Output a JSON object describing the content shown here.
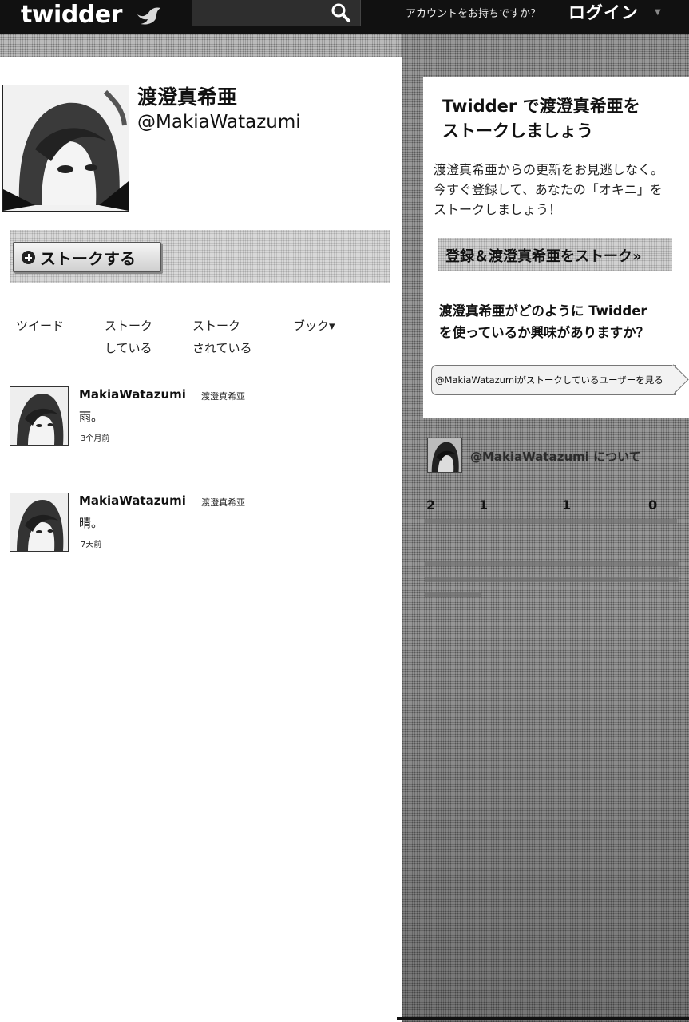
{
  "topbar": {
    "logo": "twidder",
    "login_question": "アカウントをお持ちですか？",
    "login_link": "ログイン",
    "login_caret": "▼"
  },
  "profile": {
    "display_name": "渡澄真希亜",
    "handle": "@MakiaWatazumi",
    "stalk_button": "ストークする"
  },
  "stats": [
    {
      "line1": "ツイード",
      "line2": ""
    },
    {
      "line1": "ストーク",
      "line2": "している"
    },
    {
      "line1": "ストーク",
      "line2": "されている"
    },
    {
      "line1": "ブック▾",
      "line2": ""
    }
  ],
  "tweets": [
    {
      "user": "MakiaWatazumi",
      "name": "渡澄真希亚",
      "text": "雨。",
      "time": "3个月前"
    },
    {
      "user": "MakiaWatazumi",
      "name": "渡澄真希亚",
      "text": "晴。",
      "time": "7天前"
    }
  ],
  "signup": {
    "title_line1": "Twidder で渡澄真希亜を",
    "title_line2": "ストークしましょう",
    "desc_line1": "渡澄真希亜からの更新をお見逃しなく。",
    "desc_line2": "今すぐ登録して、あなたの「オキニ」を",
    "desc_line3": "ストークしましょう！",
    "button": "登録＆渡澄真希亜をストーク»",
    "curious_line1": "渡澄真希亜がどのように Twidder",
    "curious_line2": "を使っているか興味がありますか？",
    "following_link": "@MakiaWatazumiがストークしているユーザーを見る"
  },
  "about": {
    "title": "@MakiaWatazumi について",
    "stats": [
      "2",
      "1",
      "1",
      "0"
    ]
  },
  "colors": {
    "topbar": "#111111",
    "halftone": "#9a9a9a"
  }
}
